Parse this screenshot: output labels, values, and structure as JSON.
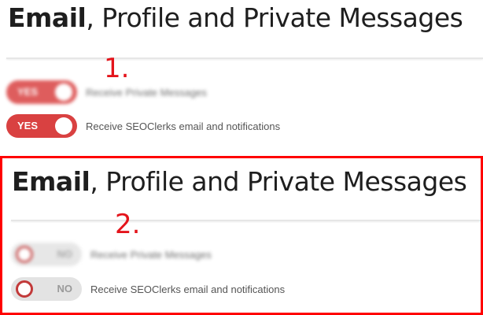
{
  "panel1": {
    "title_bold": "Email",
    "title_rest": ", Profile and Private Messages",
    "step_number": "1.",
    "rows": [
      {
        "state": "YES",
        "label": "Receive Private Messages"
      },
      {
        "state": "YES",
        "label": "Receive SEOClerks email and notifications"
      }
    ]
  },
  "panel2": {
    "title_bold": "Email",
    "title_rest": ", Profile and Private Messages",
    "step_number": "2.",
    "rows": [
      {
        "state": "NO",
        "label": "Receive Private Messages"
      },
      {
        "state": "NO",
        "label": "Receive SEOClerks email and notifications"
      }
    ]
  },
  "colors": {
    "toggle_on": "#d94141",
    "toggle_off": "#e3e3e3",
    "highlight_frame": "#ff0000",
    "step_number": "#e4141b"
  }
}
